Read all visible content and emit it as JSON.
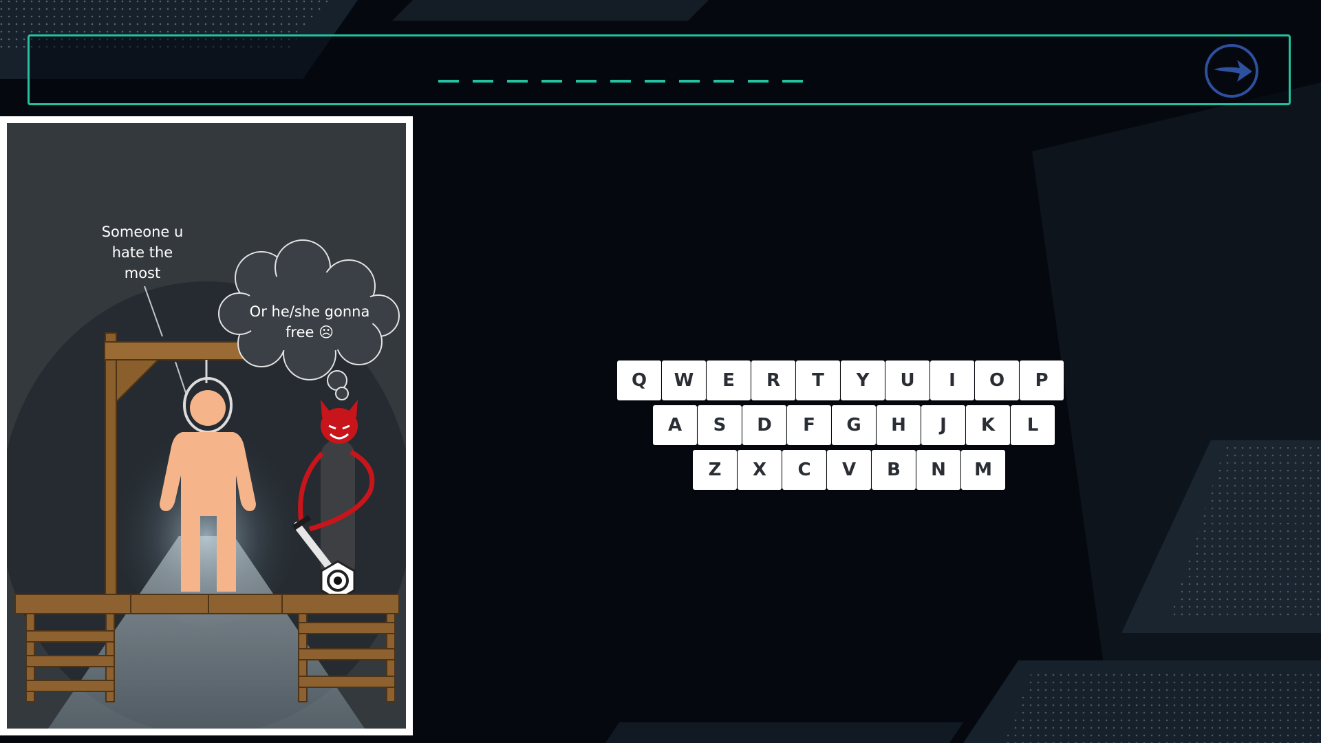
{
  "game": {
    "blank_count": 11,
    "revealed": [
      "",
      "",
      "",
      "",
      "",
      "",
      "",
      "",
      "",
      "",
      ""
    ],
    "accent_color": "#23c2a0"
  },
  "scene": {
    "label": "Someone u hate the most",
    "label_lines": [
      "Someone u",
      "hate the",
      "most"
    ],
    "thought": "Or he/she gonna free ☹",
    "thought_lines": [
      "Or he/she gonna",
      "free ☹"
    ]
  },
  "next_button": {
    "icon": "arrow-right-icon",
    "color": "#2f4f9f"
  },
  "keyboard": {
    "rows": [
      [
        "Q",
        "W",
        "E",
        "R",
        "T",
        "Y",
        "U",
        "I",
        "O",
        "P"
      ],
      [
        "A",
        "S",
        "D",
        "F",
        "G",
        "H",
        "J",
        "K",
        "L"
      ],
      [
        "Z",
        "X",
        "C",
        "V",
        "B",
        "N",
        "M"
      ]
    ]
  }
}
